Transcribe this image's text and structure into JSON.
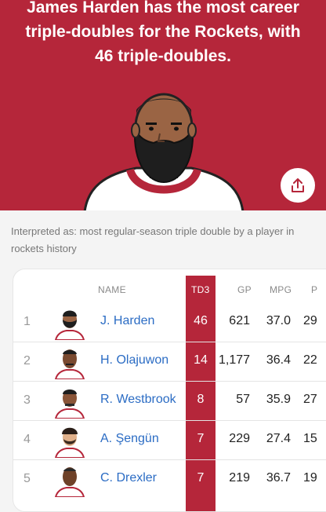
{
  "hero": {
    "headline": "James Harden has the most career triple-doubles for the Rockets, with 46 triple-doubles.",
    "featured_player_icon": "player-portrait",
    "share_icon": "share-upload-icon",
    "background_color": "#b5263a"
  },
  "interpretation": "Interpreted as: most regular-season triple double by a player in rockets history",
  "table": {
    "headers": {
      "name": "NAME",
      "td3": "TD3",
      "gp": "GP",
      "mpg": "MPG",
      "pts": "P"
    },
    "rows": [
      {
        "rank": "1",
        "name": "J. Harden",
        "td3": "46",
        "gp": "621",
        "mpg": "37.0",
        "pts": "29"
      },
      {
        "rank": "2",
        "name": "H. Olajuwon",
        "td3": "14",
        "gp": "1,177",
        "mpg": "36.4",
        "pts": "22"
      },
      {
        "rank": "3",
        "name": "R. Westbrook",
        "td3": "8",
        "gp": "57",
        "mpg": "35.9",
        "pts": "27"
      },
      {
        "rank": "4",
        "name": "A. Şengün",
        "td3": "7",
        "gp": "229",
        "mpg": "27.4",
        "pts": "15"
      },
      {
        "rank": "5",
        "name": "C. Drexler",
        "td3": "7",
        "gp": "219",
        "mpg": "36.7",
        "pts": "19"
      }
    ]
  }
}
